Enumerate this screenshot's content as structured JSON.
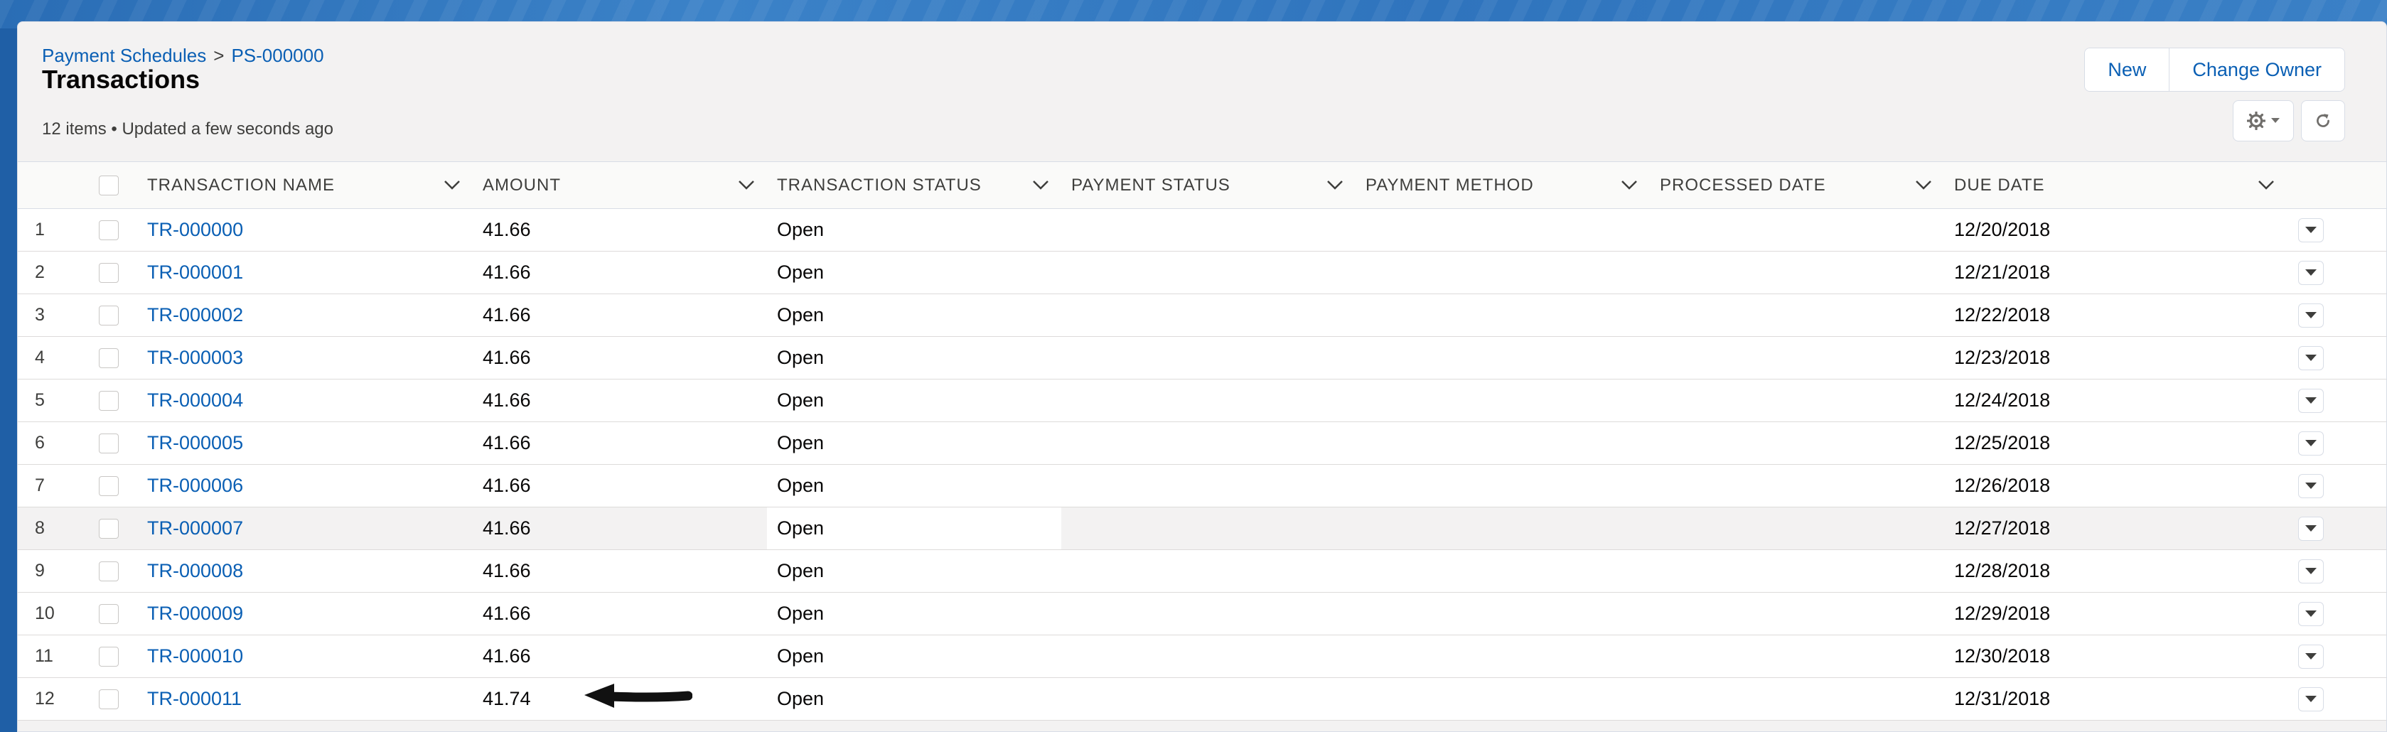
{
  "breadcrumb": {
    "parent": "Payment Schedules",
    "separator": ">",
    "record": "PS-000000"
  },
  "page": {
    "title": "Transactions",
    "meta": "12 items • Updated a few seconds ago"
  },
  "actions": {
    "new_label": "New",
    "change_owner_label": "Change Owner"
  },
  "icons": {
    "settings": "gear-icon",
    "refresh": "refresh-icon",
    "column_menu": "chevron-down-icon",
    "row_menu": "caret-down-icon",
    "annotation": "arrow-left-icon"
  },
  "columns": {
    "name": "TRANSACTION NAME",
    "amount": "AMOUNT",
    "status": "TRANSACTION STATUS",
    "payment_status": "PAYMENT STATUS",
    "payment_method": "PAYMENT METHOD",
    "processed_date": "PROCESSED DATE",
    "due_date": "DUE DATE"
  },
  "rows": [
    {
      "num": "1",
      "name": "TR-000000",
      "amount": "41.66",
      "status": "Open",
      "payment_status": "",
      "payment_method": "",
      "processed_date": "",
      "due_date": "12/20/2018"
    },
    {
      "num": "2",
      "name": "TR-000001",
      "amount": "41.66",
      "status": "Open",
      "payment_status": "",
      "payment_method": "",
      "processed_date": "",
      "due_date": "12/21/2018"
    },
    {
      "num": "3",
      "name": "TR-000002",
      "amount": "41.66",
      "status": "Open",
      "payment_status": "",
      "payment_method": "",
      "processed_date": "",
      "due_date": "12/22/2018"
    },
    {
      "num": "4",
      "name": "TR-000003",
      "amount": "41.66",
      "status": "Open",
      "payment_status": "",
      "payment_method": "",
      "processed_date": "",
      "due_date": "12/23/2018"
    },
    {
      "num": "5",
      "name": "TR-000004",
      "amount": "41.66",
      "status": "Open",
      "payment_status": "",
      "payment_method": "",
      "processed_date": "",
      "due_date": "12/24/2018"
    },
    {
      "num": "6",
      "name": "TR-000005",
      "amount": "41.66",
      "status": "Open",
      "payment_status": "",
      "payment_method": "",
      "processed_date": "",
      "due_date": "12/25/2018"
    },
    {
      "num": "7",
      "name": "TR-000006",
      "amount": "41.66",
      "status": "Open",
      "payment_status": "",
      "payment_method": "",
      "processed_date": "",
      "due_date": "12/26/2018"
    },
    {
      "num": "8",
      "name": "TR-000007",
      "amount": "41.66",
      "status": "Open",
      "payment_status": "",
      "payment_method": "",
      "processed_date": "",
      "due_date": "12/27/2018"
    },
    {
      "num": "9",
      "name": "TR-000008",
      "amount": "41.66",
      "status": "Open",
      "payment_status": "",
      "payment_method": "",
      "processed_date": "",
      "due_date": "12/28/2018"
    },
    {
      "num": "10",
      "name": "TR-000009",
      "amount": "41.66",
      "status": "Open",
      "payment_status": "",
      "payment_method": "",
      "processed_date": "",
      "due_date": "12/29/2018"
    },
    {
      "num": "11",
      "name": "TR-000010",
      "amount": "41.66",
      "status": "Open",
      "payment_status": "",
      "payment_method": "",
      "processed_date": "",
      "due_date": "12/30/2018"
    },
    {
      "num": "12",
      "name": "TR-000011",
      "amount": "41.74",
      "status": "Open",
      "payment_status": "",
      "payment_method": "",
      "processed_date": "",
      "due_date": "12/31/2018"
    }
  ],
  "colors": {
    "link": "#0a5fb4",
    "header_bg": "#1f5fa6",
    "card_bg": "#f3f2f2",
    "highlight_row": "#f3f2f2"
  }
}
